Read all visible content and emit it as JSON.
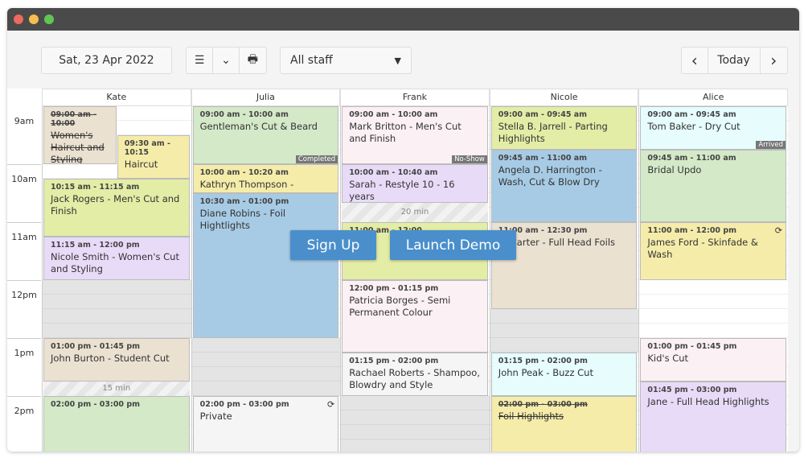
{
  "window": {
    "traffic_lights": [
      "#ec6a5e",
      "#f4bf4f",
      "#61c554"
    ]
  },
  "toolbar": {
    "date": "Sat, 23 Apr 2022",
    "icons": [
      "sliders-icon",
      "double-chevron-down-icon",
      "printer-icon"
    ],
    "staff_select": "All staff",
    "prev": "‹",
    "today": "Today",
    "next": "›"
  },
  "hours": [
    "9am",
    "10am",
    "11am",
    "12pm",
    "1pm",
    "2pm"
  ],
  "staff": [
    "Kate",
    "Julia",
    "Frank",
    "Nicole",
    "Alice"
  ],
  "colors": {
    "tan": "#ebe1d1",
    "yellow": "#f5ecaa",
    "lime": "#e3eda6",
    "lavender": "#e8dbf8",
    "green": "#d3e9c8",
    "blue": "#a7cbe5",
    "pink": "#fbf0f4",
    "cyan": "#e6fcfd",
    "grey": "#f5f5f5",
    "accent": "#4a8fcb"
  },
  "blocked": [
    {
      "col": 0,
      "start": "12:00",
      "end": "13:00"
    },
    {
      "col": 1,
      "start": "13:00",
      "end": "14:00"
    },
    {
      "col": 2,
      "start": "14:00",
      "end": "15:00"
    },
    {
      "col": 3,
      "start": "12:30",
      "end": "13:15"
    }
  ],
  "gaps": [
    {
      "col": 2,
      "start": "10:40",
      "end": "11:00",
      "label": "20 min"
    },
    {
      "col": 0,
      "start": "13:45",
      "end": "14:00",
      "label": "15 min"
    }
  ],
  "events": [
    {
      "col": 0,
      "half": "left",
      "start": "09:00",
      "end": "10:00",
      "time": "09:00 am - 10:00",
      "title": "Women's Haircut and Styling",
      "color": "tan",
      "cancelled": true
    },
    {
      "col": 0,
      "half": "right",
      "start": "09:30",
      "end": "10:15",
      "time": "09:30 am - 10:15",
      "title": "Haircut",
      "color": "yellow"
    },
    {
      "col": 0,
      "start": "10:15",
      "end": "11:15",
      "time": "10:15 am - 11:15 am",
      "title": "Jack Rogers - Men's Cut and Finish",
      "color": "lime"
    },
    {
      "col": 0,
      "start": "11:15",
      "end": "12:00",
      "time": "11:15 am - 12:00 pm",
      "title": "Nicole Smith - Women's Cut and Styling",
      "color": "lavender"
    },
    {
      "col": 0,
      "start": "13:00",
      "end": "13:45",
      "time": "01:00 pm - 01:45 pm",
      "title": "John Burton - Student Cut",
      "color": "tan"
    },
    {
      "col": 0,
      "start": "14:00",
      "end": "15:00",
      "time": "02:00 pm - 03:00 pm",
      "title": "",
      "color": "green"
    },
    {
      "col": 1,
      "start": "09:00",
      "end": "10:00",
      "time": "09:00 am - 10:00 am",
      "title": "Gentleman's Cut & Beard",
      "color": "green",
      "badge": "Completed"
    },
    {
      "col": 1,
      "start": "10:00",
      "end": "10:30",
      "time": "10:00 am - 10:20 am",
      "title": "Kathryn Thompson -",
      "color": "yellow"
    },
    {
      "col": 1,
      "start": "10:30",
      "end": "13:00",
      "time": "10:30 am - 01:00 pm",
      "title": "Diane Robins - Foil Hightlights",
      "color": "blue"
    },
    {
      "col": 1,
      "start": "14:00",
      "end": "15:00",
      "time": "02:00 pm - 03:00 pm",
      "title": "Private",
      "color": "grey",
      "recurring": true
    },
    {
      "col": 2,
      "start": "09:00",
      "end": "10:00",
      "time": "09:00 am - 10:00 am",
      "title": "Mark Britton - Men's Cut and Finish",
      "color": "pink",
      "badge": "No-Show"
    },
    {
      "col": 2,
      "start": "10:00",
      "end": "10:40",
      "time": "10:00 am - 10:40 am",
      "title": "Sarah - Restyle 10 - 16 years",
      "color": "lavender"
    },
    {
      "col": 2,
      "start": "11:00",
      "end": "12:00",
      "time": "11:00 am - 12:00",
      "title": "",
      "color": "lime"
    },
    {
      "col": 2,
      "start": "12:00",
      "end": "13:15",
      "time": "12:00 pm - 01:15 pm",
      "title": "Patricia Borges - Semi Permanent Colour",
      "color": "pink"
    },
    {
      "col": 2,
      "start": "13:15",
      "end": "14:00",
      "time": "01:15 pm - 02:00 pm",
      "title": "Rachael Roberts - Shampoo, Blowdry and Style",
      "color": "grey"
    },
    {
      "col": 3,
      "start": "09:00",
      "end": "09:45",
      "time": "09:00 am - 09:45 am",
      "title": "Stella B. Jarrell - Parting Highlights",
      "color": "lime"
    },
    {
      "col": 3,
      "start": "09:45",
      "end": "11:00",
      "time": "09:45 am - 11:00 am",
      "title": "Angela D. Harrington - Wash, Cut & Blow Dry",
      "color": "blue"
    },
    {
      "col": 3,
      "start": "11:00",
      "end": "12:30",
      "time": "11:00 am - 12:30 pm",
      "title": "A. Carter - Full Head Foils",
      "color": "tan"
    },
    {
      "col": 3,
      "start": "13:15",
      "end": "14:00",
      "time": "01:15 pm - 02:00 pm",
      "title": "John Peak - Buzz Cut",
      "color": "cyan"
    },
    {
      "col": 3,
      "start": "14:00",
      "end": "15:00",
      "time": "02:00 pm - 03:00 pm",
      "title": "Foil Highlights",
      "color": "yellow",
      "cancelled": true
    },
    {
      "col": 4,
      "start": "09:00",
      "end": "09:45",
      "time": "09:00 am - 09:45 am",
      "title": "Tom Baker - Dry Cut",
      "color": "cyan",
      "badge": "Arrived"
    },
    {
      "col": 4,
      "start": "09:45",
      "end": "11:00",
      "time": "09:45 am - 11:00 am",
      "title": "Bridal Updo",
      "color": "green"
    },
    {
      "col": 4,
      "start": "11:00",
      "end": "12:00",
      "time": "11:00 am - 12:00 pm",
      "title": "James Ford - Skinfade & Wash",
      "color": "yellow",
      "recurring": true
    },
    {
      "col": 4,
      "start": "13:00",
      "end": "13:45",
      "time": "01:00 pm - 01:45 pm",
      "title": "Kid's Cut",
      "color": "pink"
    },
    {
      "col": 4,
      "start": "13:45",
      "end": "15:00",
      "time": "01:45 pm - 03:00 pm",
      "title": "Jane - Full Head Highlights",
      "color": "lavender"
    }
  ],
  "overlay": {
    "signup": "Sign Up",
    "demo": "Launch Demo"
  }
}
